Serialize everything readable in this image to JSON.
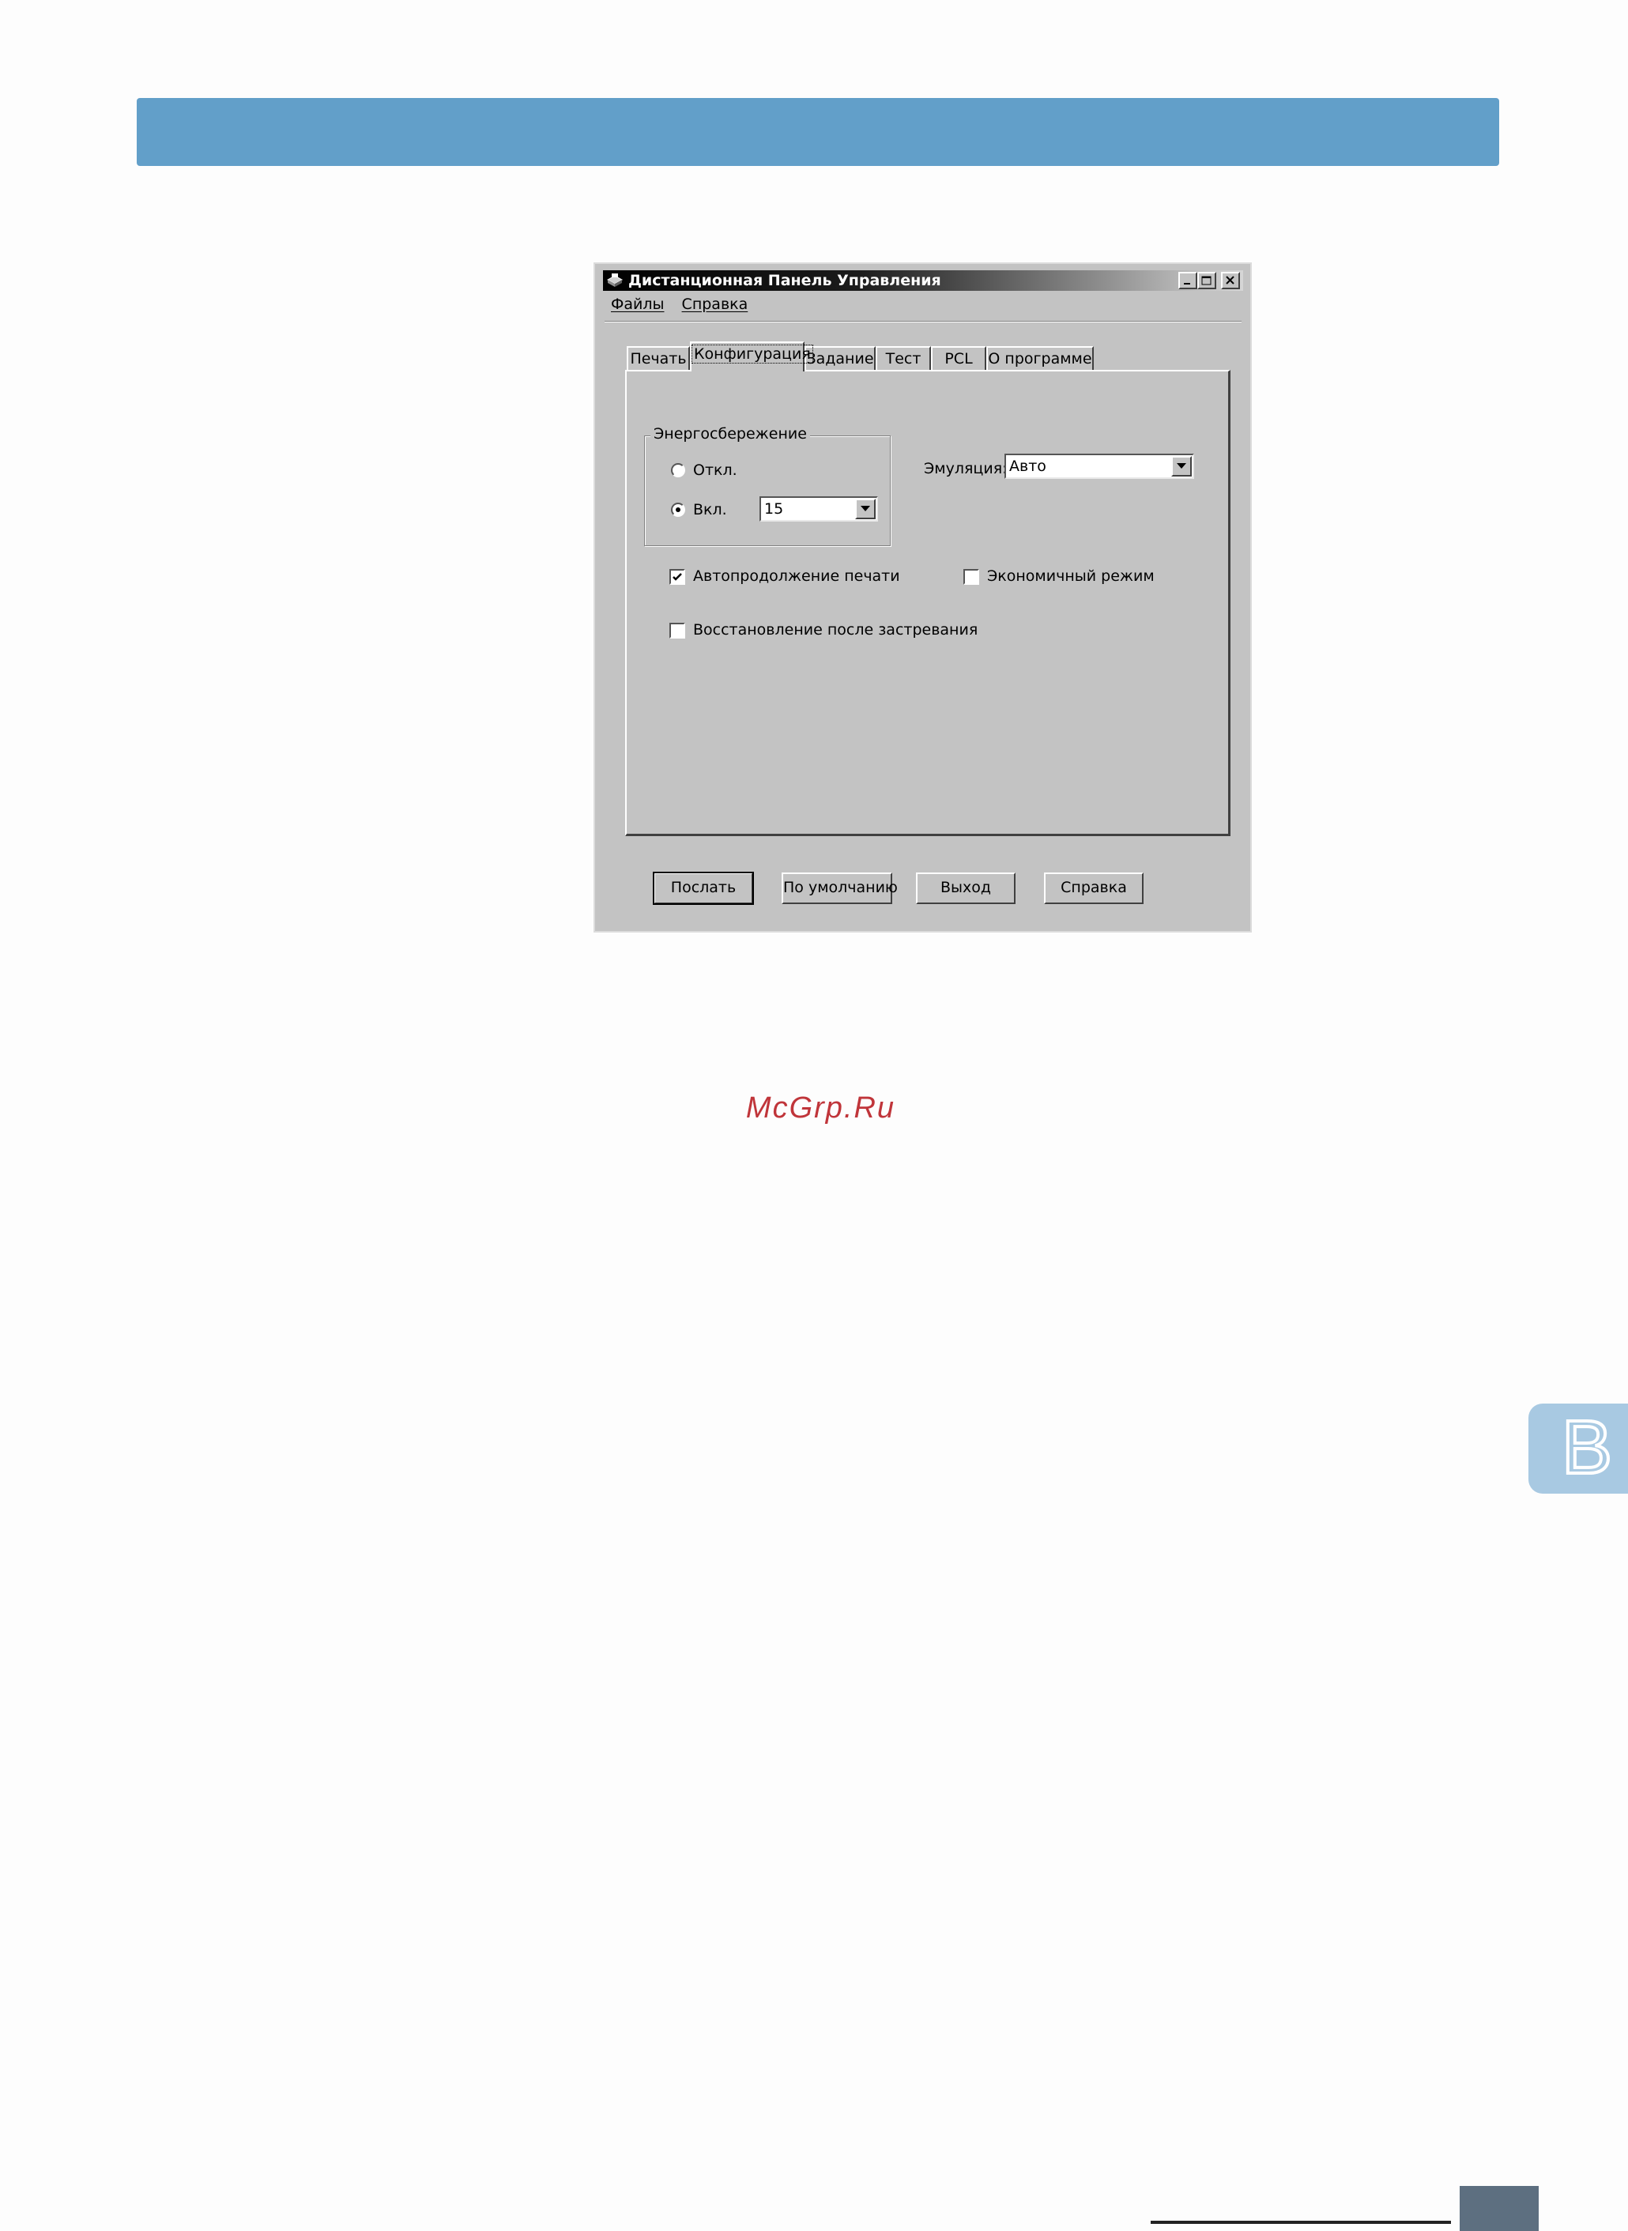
{
  "window": {
    "title": "Дистанционная Панель Управления"
  },
  "menu": {
    "items": [
      "Файлы",
      "Справка"
    ]
  },
  "tabs": [
    {
      "label": "Печать",
      "active": false
    },
    {
      "label": "Конфигурация",
      "active": true
    },
    {
      "label": "Задание",
      "active": false
    },
    {
      "label": "Тест",
      "active": false
    },
    {
      "label": "PCL",
      "active": false
    },
    {
      "label": "О программе",
      "active": false
    }
  ],
  "config": {
    "power_save": {
      "group_label": "Энергосбережение",
      "off_label": "Откл.",
      "on_label": "Вкл.",
      "selected": "on",
      "timeout_value": "15"
    },
    "emulation": {
      "label": "Эмуляция:",
      "value": "Авто"
    },
    "auto_continue": {
      "label": "Автопродолжение печати",
      "checked": true
    },
    "economy_mode": {
      "label": "Экономичный режим",
      "checked": false
    },
    "jam_recovery": {
      "label": "Восстановление после застревания",
      "checked": false
    }
  },
  "buttons": {
    "send": "Послать",
    "defaults": "По умолчанию",
    "exit": "Выход",
    "help": "Справка"
  },
  "page": {
    "watermark": "McGrp.Ru",
    "section_tab_letter": "B",
    "banner_color": "#629fc9",
    "watermark_color": "#c0353a"
  }
}
